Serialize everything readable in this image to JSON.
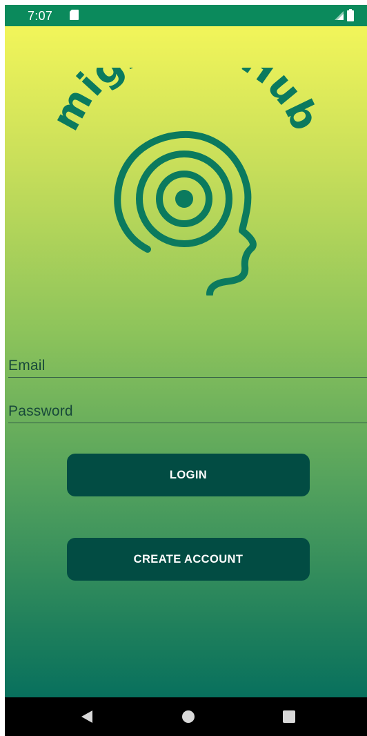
{
  "status_bar": {
    "time": "7:07",
    "icons": [
      "sd-card-icon",
      "signal-icon",
      "battery-icon"
    ],
    "background_color": "#0b8a5c"
  },
  "logo": {
    "text": "migraineHub",
    "color": "#0b7a5e",
    "icon": "head-concentric-circles-icon"
  },
  "form": {
    "email_placeholder": "Email",
    "password_placeholder": "Password"
  },
  "buttons": {
    "login_label": "LOGIN",
    "create_account_label": "CREATE ACCOUNT",
    "color": "#024c43"
  },
  "nav_bar": {
    "icons": [
      "back-icon",
      "home-icon",
      "recents-icon"
    ]
  },
  "colors": {
    "gradient_top": "#f2f55a",
    "gradient_bottom": "#08705d",
    "input_line": "#2f5a45",
    "input_text": "#18493a"
  }
}
